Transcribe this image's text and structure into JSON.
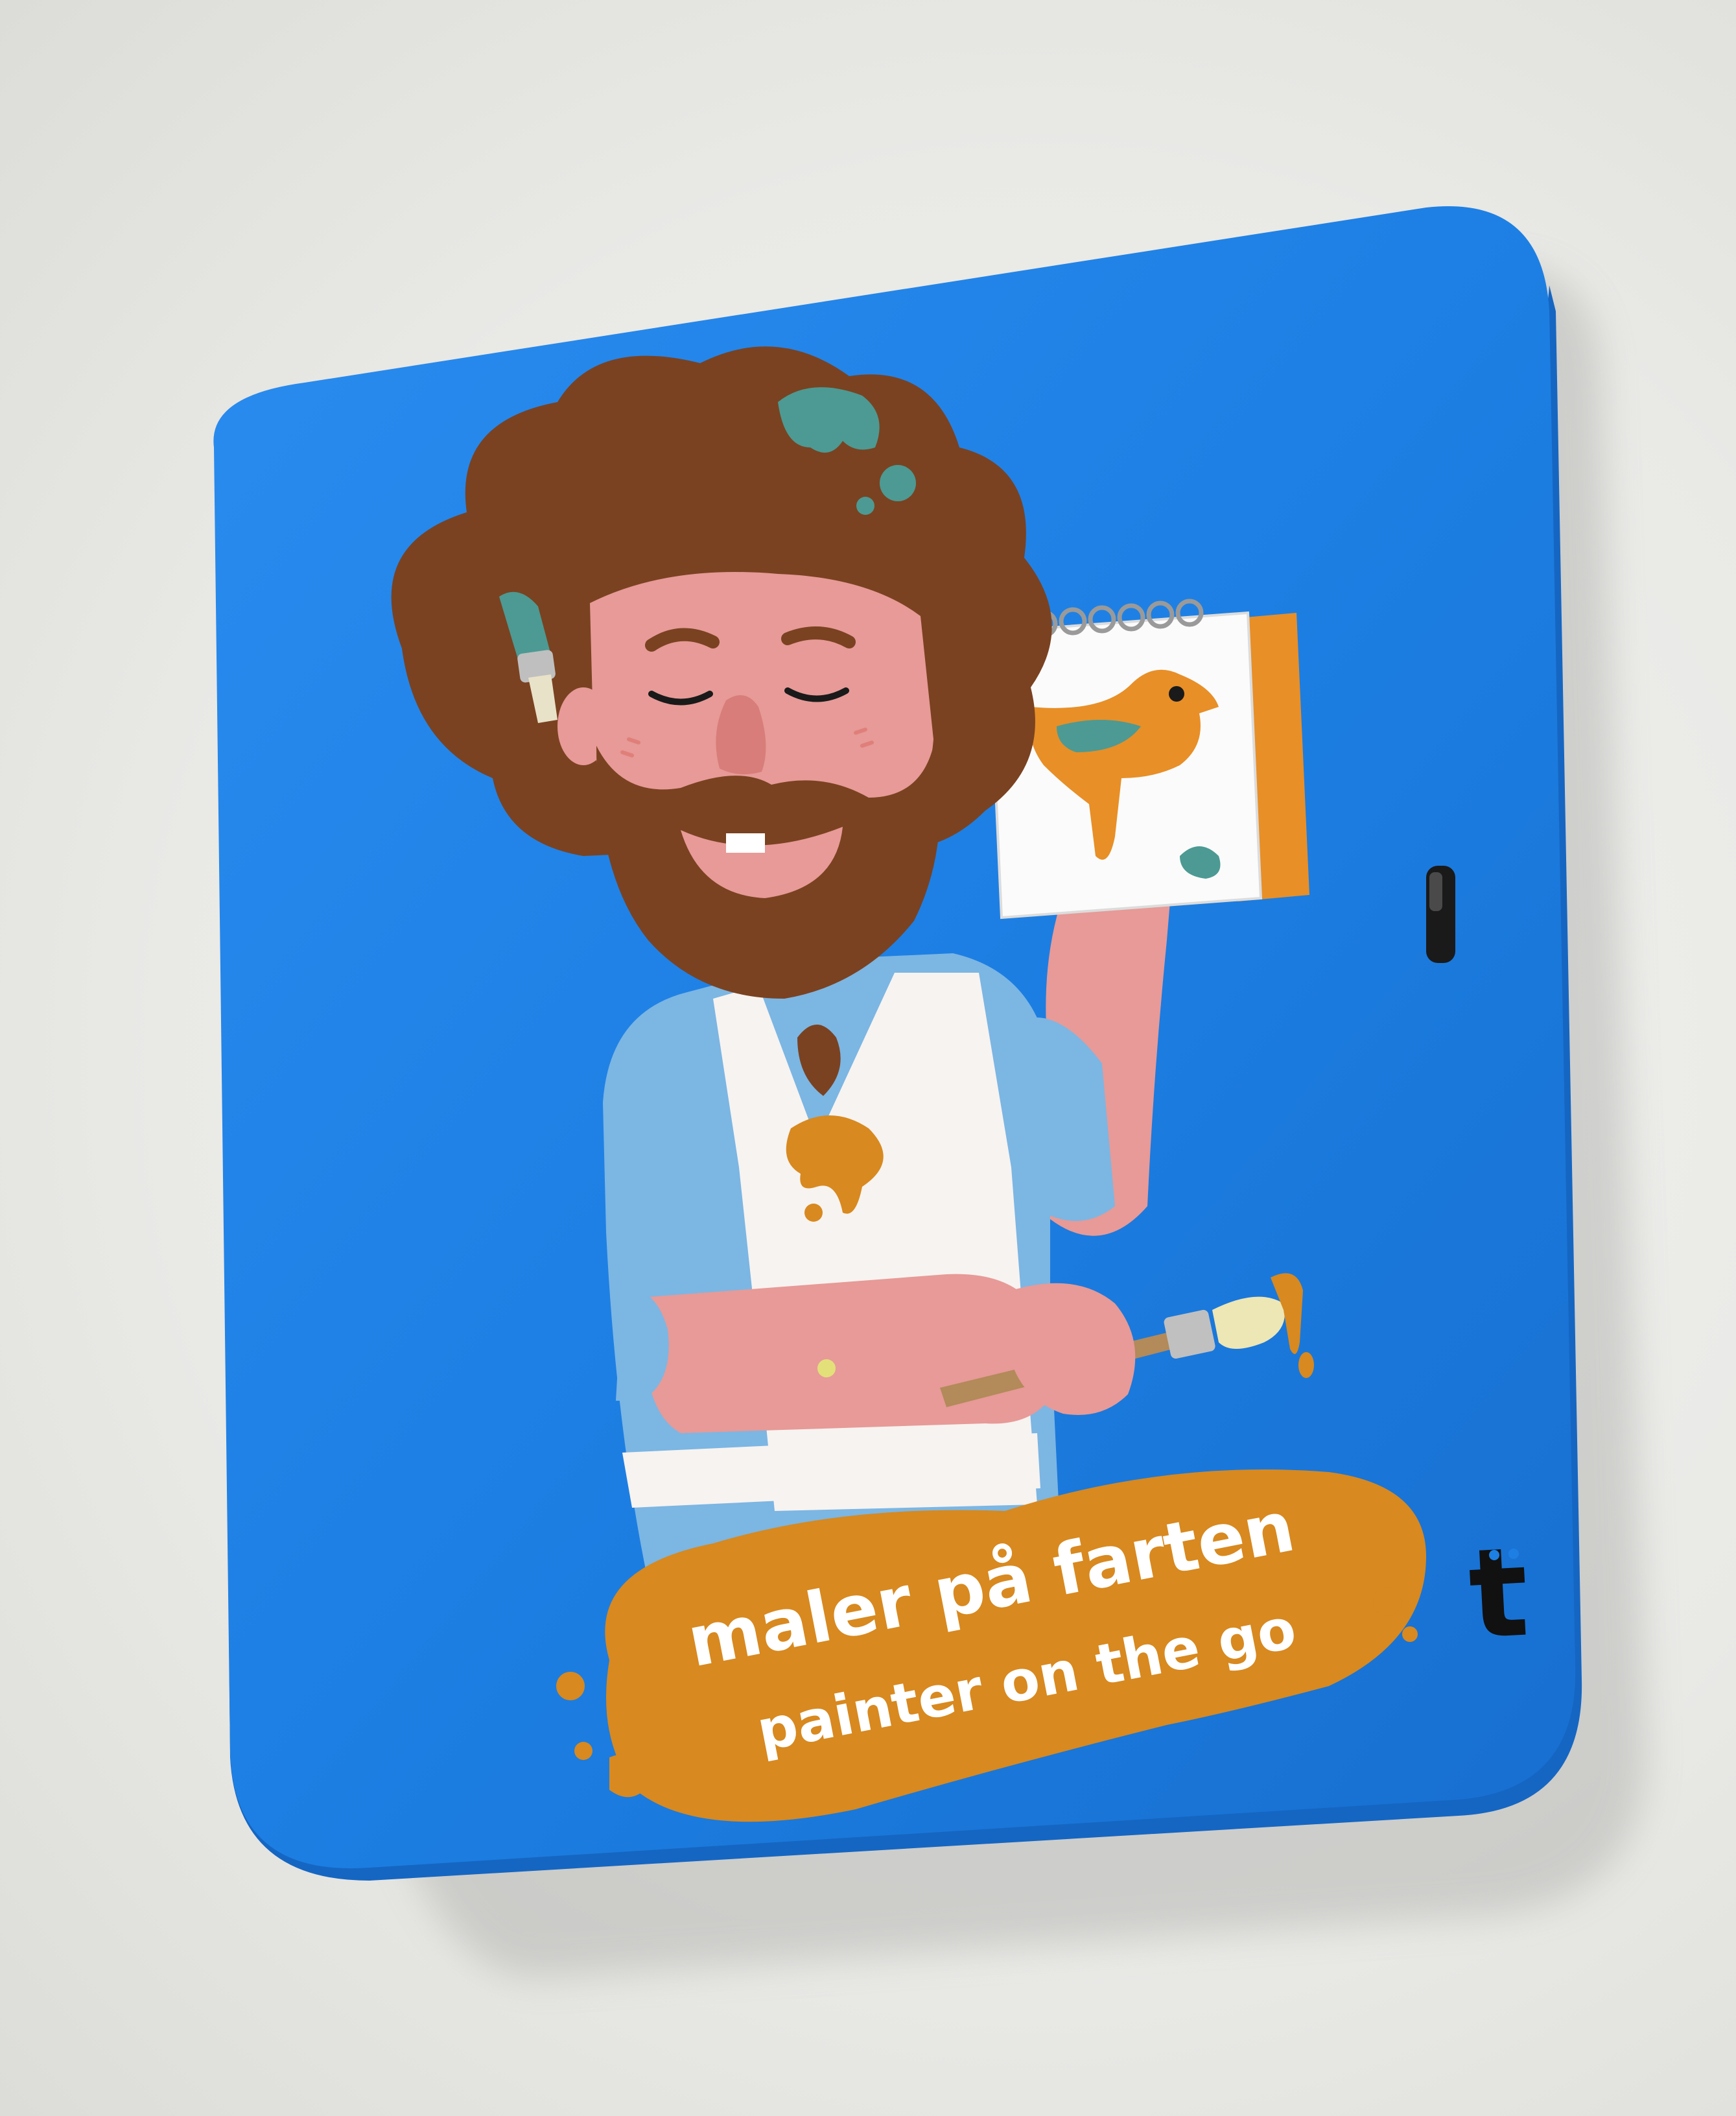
{
  "product": {
    "title_no": "maler på farten",
    "title_en": "painter on the go",
    "brand_mark": "t"
  },
  "colors": {
    "tin_blue": "#1d7fe3",
    "tin_blue_edge": "#1566c2",
    "paint_splash": "#d8891f",
    "hair_brown": "#7a4221",
    "skin": "#e79a97",
    "shirt_blue": "#7cb6e3",
    "apron_white": "#f7f3f0",
    "teal_paint": "#4c9a93",
    "background": "#ececea"
  },
  "icons": {
    "brand_logo": "t-letter-logo-icon",
    "paintbrush": "paintbrush-icon",
    "sketchpad": "sketchpad-icon",
    "bird_drawing": "bird-drawing-icon"
  }
}
